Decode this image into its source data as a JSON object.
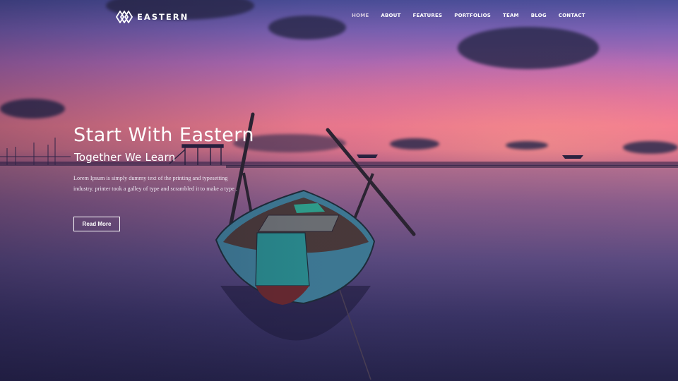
{
  "brand": {
    "name": "EASTERN",
    "logo_icon": "diamond-lattice-icon"
  },
  "nav": {
    "items": [
      {
        "label": "HOME",
        "active": true
      },
      {
        "label": "ABOUT",
        "active": false
      },
      {
        "label": "FEATURES",
        "active": false
      },
      {
        "label": "PORTFOLIOS",
        "active": false
      },
      {
        "label": "TEAM",
        "active": false
      },
      {
        "label": "BLOG",
        "active": false
      },
      {
        "label": "CONTACT",
        "active": false
      }
    ]
  },
  "hero": {
    "title": "Start With Eastern",
    "subtitle": "Together We Learn",
    "description": "Lorem Ipsum is simply dummy text of the printing and typesetting industry. printer took a galley of type and scrambled it to make a type .",
    "cta_label": "Read More",
    "background": "sunset-lake-boat-photo"
  },
  "colors": {
    "text": "#ffffff",
    "sky_top": "#4b4f9a",
    "sky_pink": "#ef7d8f",
    "water_dark": "#25234a"
  }
}
